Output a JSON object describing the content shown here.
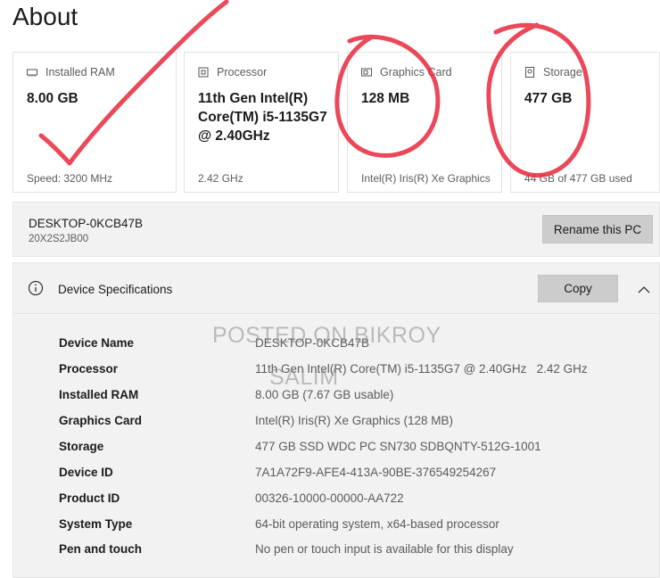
{
  "page": {
    "title": "About"
  },
  "cards": [
    {
      "icon": "ram-icon",
      "label": "Installed RAM",
      "value": "8.00 GB",
      "sub": "Speed: 3200 MHz"
    },
    {
      "icon": "processor-icon",
      "label": "Processor",
      "value": "11th Gen Intel(R) Core(TM) i5-1135G7 @ 2.40GHz",
      "sub": "2.42 GHz"
    },
    {
      "icon": "graphics-card-icon",
      "label": "Graphics Card",
      "value": "128 MB",
      "sub": "Intel(R) Iris(R) Xe Graphics"
    },
    {
      "icon": "storage-icon",
      "label": "Storage",
      "value": "477 GB",
      "sub": "44 GB of 477 GB used"
    }
  ],
  "pc": {
    "name": "DESKTOP-0KCB47B",
    "model": "20X2S2JB00",
    "rename_label": "Rename this PC"
  },
  "device_specs": {
    "header": "Device Specifications",
    "copy_label": "Copy",
    "rows": [
      {
        "key": "Device Name",
        "value": "DESKTOP-0KCB47B"
      },
      {
        "key": "Processor",
        "value": "11th Gen Intel(R) Core(TM) i5-1135G7 @ 2.40GHz   2.42 GHz"
      },
      {
        "key": "Installed RAM",
        "value": "8.00 GB (7.67 GB usable)"
      },
      {
        "key": "Graphics Card",
        "value": "Intel(R) Iris(R) Xe Graphics (128 MB)"
      },
      {
        "key": "Storage",
        "value": "477 GB SSD WDC PC SN730 SDBQNTY-512G-1001"
      },
      {
        "key": "Device ID",
        "value": "7A1A72F9-AFE4-413A-90BE-376549254267"
      },
      {
        "key": "Product ID",
        "value": "00326-10000-00000-AA722"
      },
      {
        "key": "System Type",
        "value": "64-bit operating system, x64-based processor"
      },
      {
        "key": "Pen and touch",
        "value": "No pen or touch input is available for this display"
      }
    ]
  },
  "watermark": {
    "line1": "POSTED ON BIKROY",
    "line2": "SALIM"
  },
  "annotation": {
    "color": "#e8283c"
  }
}
